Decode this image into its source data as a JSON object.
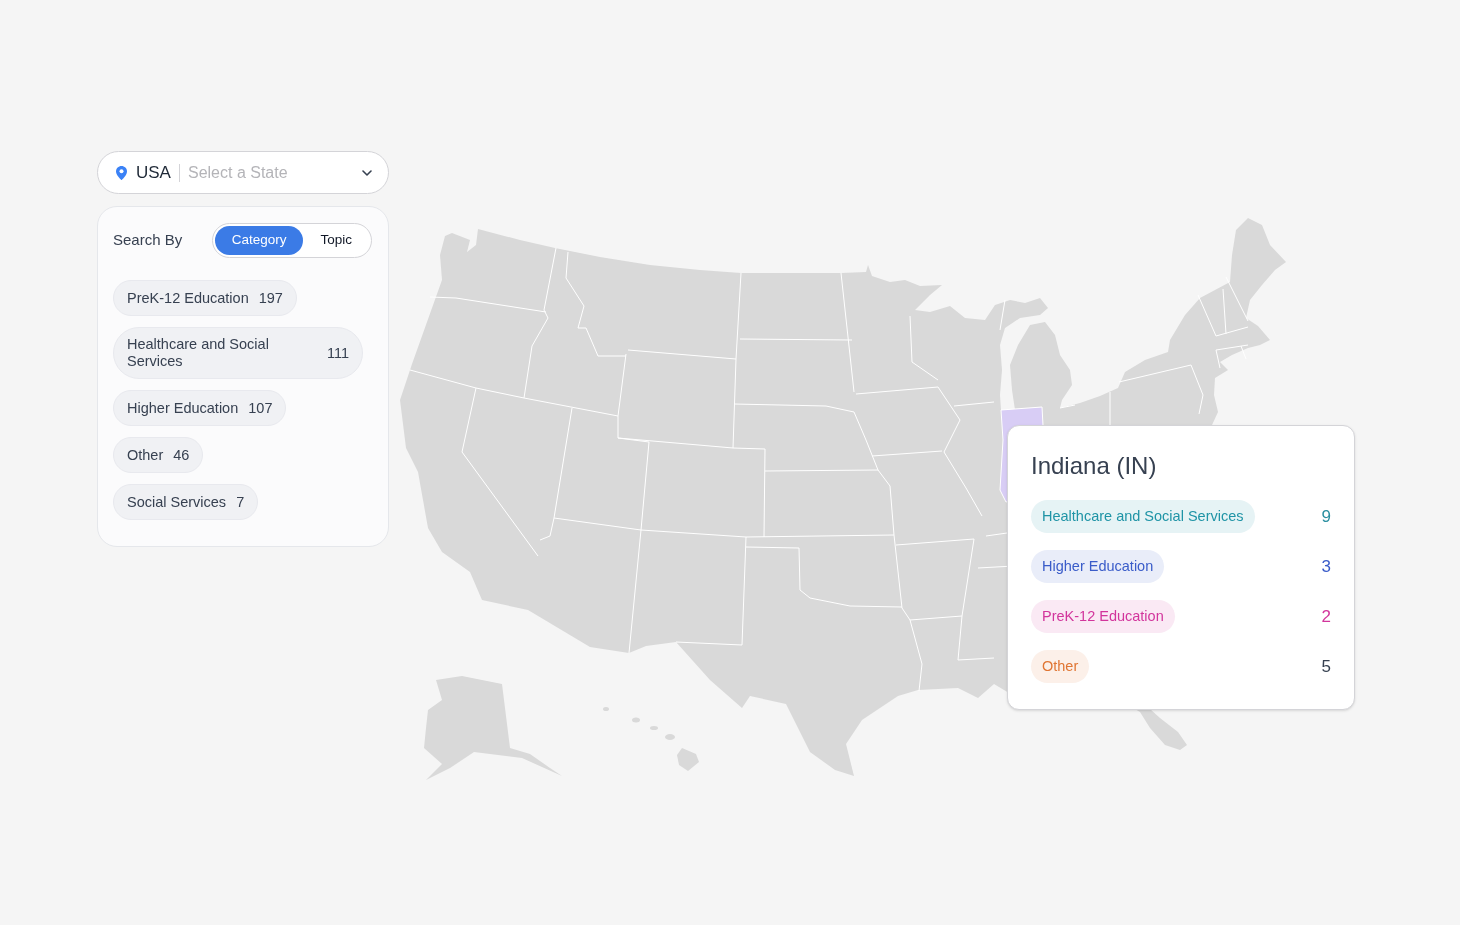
{
  "location_selector": {
    "country": "USA",
    "placeholder": "Select a State"
  },
  "search_panel": {
    "label": "Search By",
    "modes": [
      {
        "label": "Category",
        "selected": true
      },
      {
        "label": "Topic",
        "selected": false
      }
    ],
    "categories": [
      {
        "label": "PreK-12 Education",
        "count": "197"
      },
      {
        "label": "Healthcare and Social Services",
        "count": "111"
      },
      {
        "label": "Higher Education",
        "count": "107"
      },
      {
        "label": "Other",
        "count": "46"
      },
      {
        "label": "Social Services",
        "count": "7"
      }
    ]
  },
  "tooltip": {
    "title": "Indiana (IN)",
    "rows": [
      {
        "tag": {
          "label": "Healthcare and Social Services",
          "color": "#1f94a6"
        },
        "count": {
          "value": "9",
          "color": "#2a8fa0"
        }
      },
      {
        "tag": {
          "label": "Higher Education",
          "color": "#3a5cc9"
        },
        "count": {
          "value": "3",
          "color": "#3a5cc9"
        }
      },
      {
        "tag": {
          "label": "PreK-12 Education",
          "color": "#d2359c"
        },
        "count": {
          "value": "2",
          "color": "#d2359c"
        }
      },
      {
        "tag": {
          "label": "Other",
          "color": "#e07634"
        },
        "count": {
          "value": "5",
          "color": "#374151"
        }
      }
    ]
  }
}
